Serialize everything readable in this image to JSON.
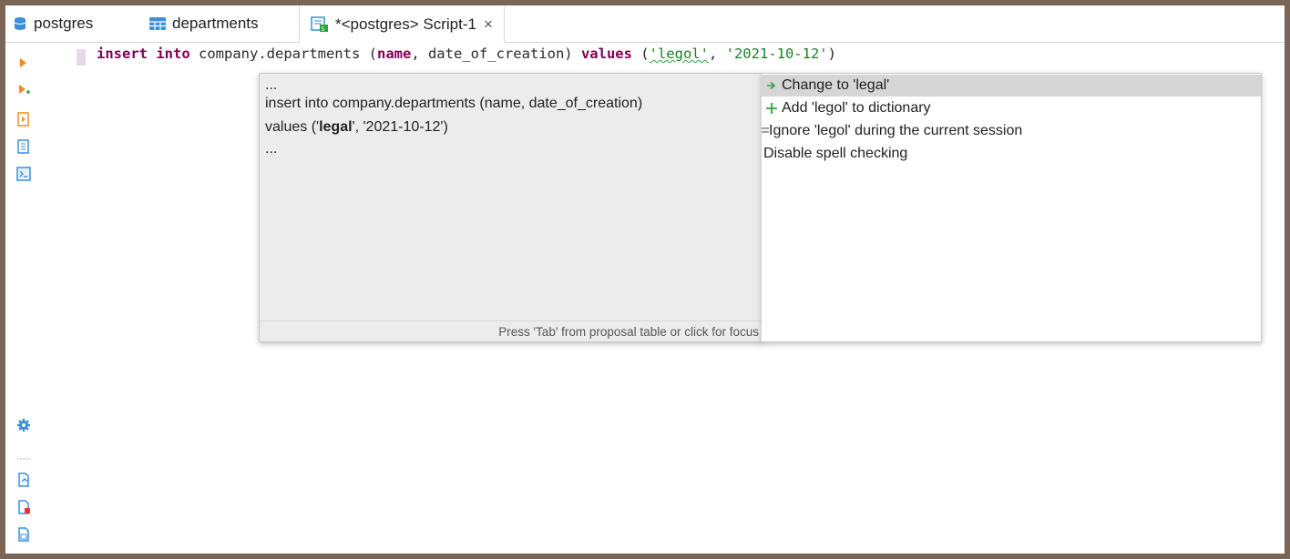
{
  "tabs": [
    {
      "label": "postgres",
      "icon": "database-icon"
    },
    {
      "label": "departments",
      "icon": "table-icon"
    },
    {
      "label": "*<postgres> Script-1",
      "icon": "sql-script-icon",
      "close": "×"
    }
  ],
  "editor": {
    "kw_insert": "insert",
    "kw_into": "into",
    "table": " company.departments (",
    "col_name": "name",
    "cols_rest": ", date_of_creation) ",
    "kw_values": "values",
    "paren_open": " (",
    "str1": "'legol'",
    "comma": ", ",
    "str2": "'2021-10-12'",
    "paren_close": ")"
  },
  "preview": {
    "line1": "...",
    "line2": "insert into company.departments (name, date_of_creation)",
    "line3_pre": "values ('",
    "line3_bold": "legal",
    "line3_post": "', '2021-10-12')",
    "line4": "...",
    "footer": "Press 'Tab' from proposal table or click for focus"
  },
  "proposals": [
    {
      "label": "Change to 'legal'",
      "icon": "change-arrow-icon"
    },
    {
      "label": "Add 'legol' to dictionary",
      "icon": "plus-icon"
    },
    {
      "label": "Ignore 'legol' during the current session",
      "icon": "ignore-icon"
    },
    {
      "label": "Disable spell checking",
      "icon": ""
    }
  ],
  "colors": {
    "keyword": "#7f0055",
    "string": "#1a7f28",
    "accent": "#3a8fd9"
  }
}
